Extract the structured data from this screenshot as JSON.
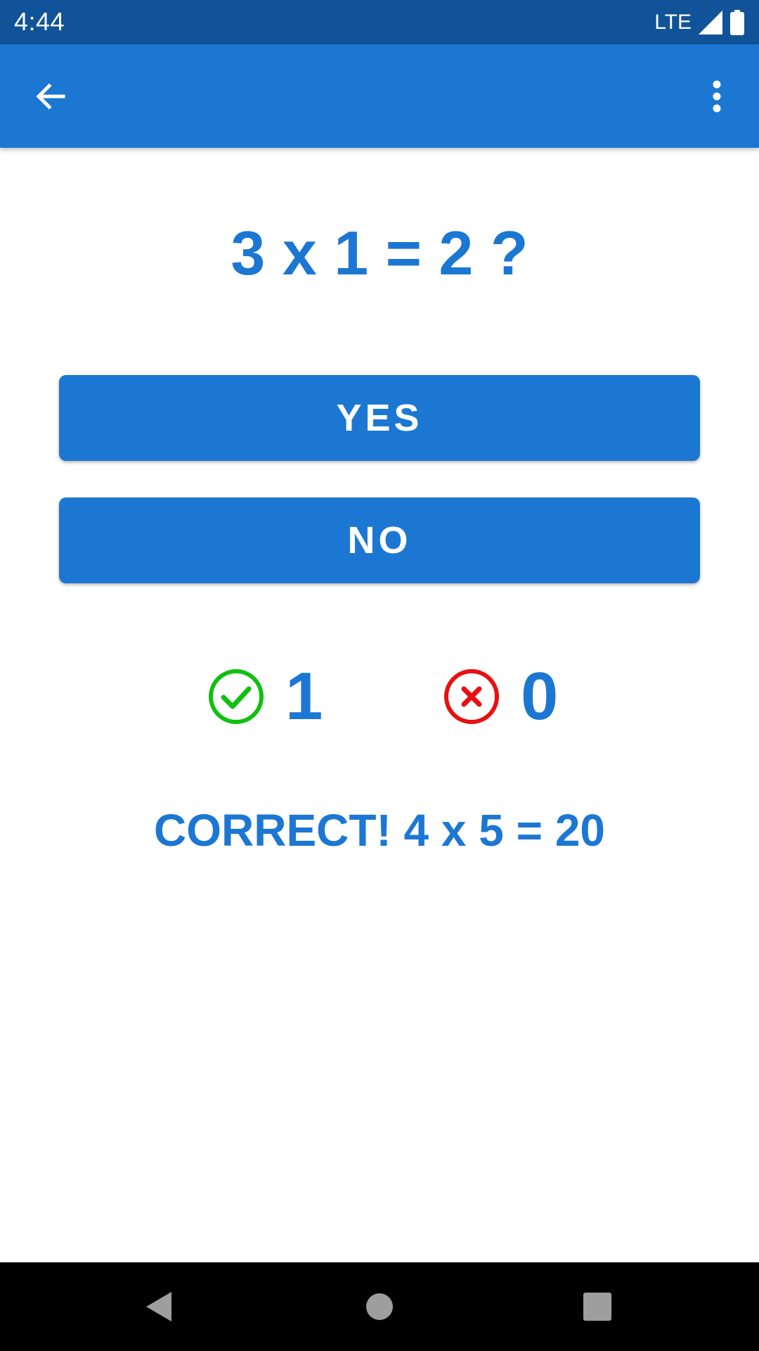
{
  "status_bar": {
    "time": "4:44",
    "network": "LTE"
  },
  "app_bar": {
    "back_icon": "arrow-back-icon",
    "menu_icon": "more-vert-icon"
  },
  "quiz": {
    "question": "3 x 1 = 2 ?",
    "yes_label": "YES",
    "no_label": "NO",
    "correct_count": "1",
    "wrong_count": "0",
    "feedback": "CORRECT! 4 x 5 = 20"
  },
  "colors": {
    "primary": "#1c77d3",
    "status_bar": "#115398",
    "correct": "#11c011",
    "wrong": "#e81010"
  }
}
